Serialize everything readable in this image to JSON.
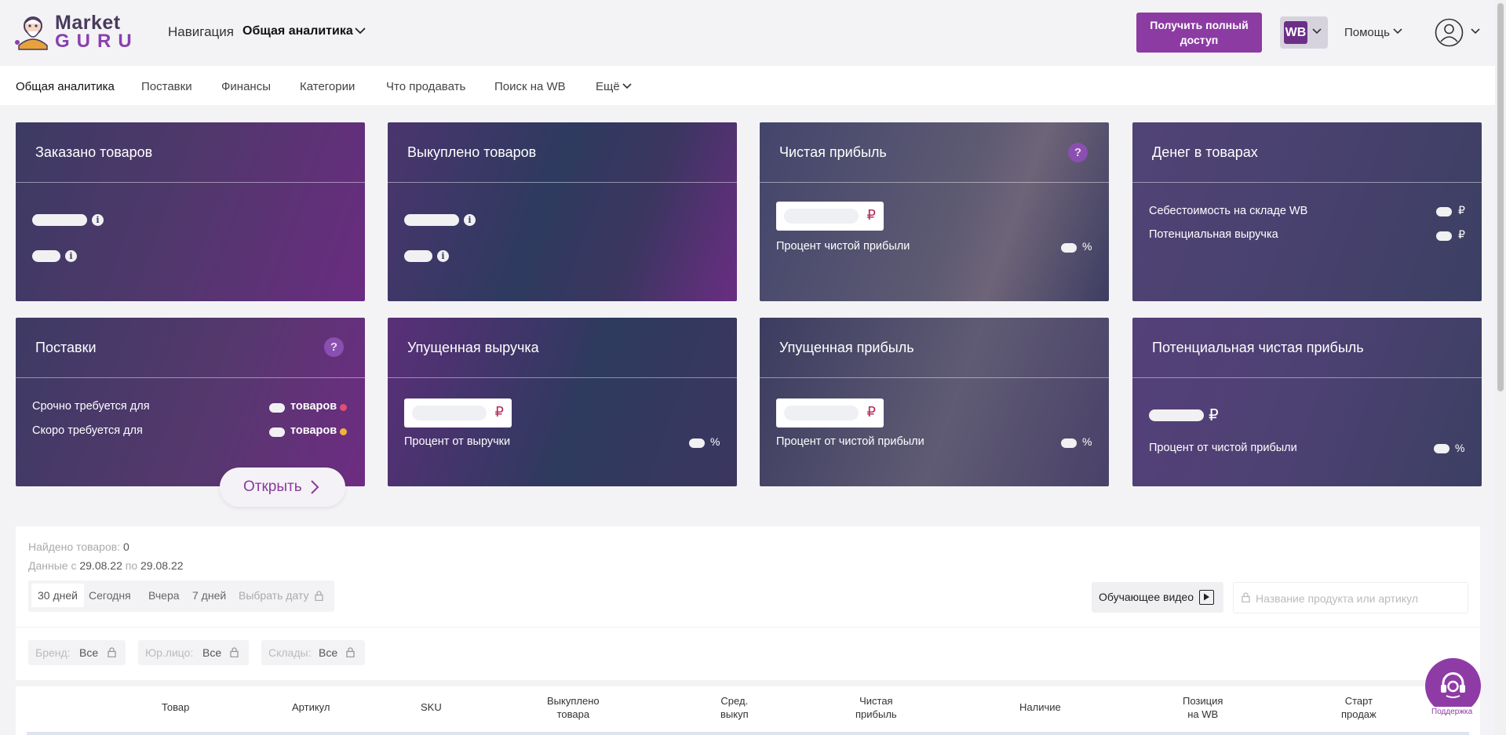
{
  "header": {
    "logo_line1": "Market",
    "logo_line2": "GURU",
    "nav_label": "Навигация",
    "nav_value": "Общая аналитика",
    "cta": "Получить полный доступ",
    "marketplace_badge": "WB",
    "help": "Помощь"
  },
  "subnav": {
    "items": [
      "Общая аналитика",
      "Поставки",
      "Финансы",
      "Категории",
      "Что продавать",
      "Поиск на WB",
      "Ещё"
    ]
  },
  "cards": {
    "ordered": {
      "title": "Заказано товаров"
    },
    "bought": {
      "title": "Выкуплено товаров"
    },
    "net_profit": {
      "title": "Чистая прибыль",
      "currency": "₽",
      "sub_label": "Процент чистой прибыли",
      "unit": "%"
    },
    "money_in_goods": {
      "title": "Денег в товарах",
      "line1": "Себестоимость на складе WB",
      "line2": "Потенциальная выручка",
      "currency": "₽"
    },
    "supplies": {
      "title": "Поставки",
      "line1": "Срочно требуется для",
      "line2": "Скоро требуется для",
      "unit": "товаров",
      "urgent_color": "#e0506e",
      "soon_color": "#f2b33d"
    },
    "lost_revenue": {
      "title": "Упущенная выручка",
      "currency": "₽",
      "sub_label": "Процент от выручки",
      "unit": "%"
    },
    "lost_profit": {
      "title": "Упущенная прибыль",
      "currency": "₽",
      "sub_label": "Процент от чистой прибыли",
      "unit": "%"
    },
    "potential_profit": {
      "title": "Потенциальная чистая прибыль",
      "currency": "₽",
      "sub_label": "Процент от чистой прибыли",
      "unit": "%"
    },
    "help_glyph": "?",
    "info_glyph": "i"
  },
  "open_button": "Открыть",
  "panel": {
    "found_label": "Найдено товаров:",
    "found_value": "0",
    "dates_label1": "Данные с",
    "date_from": "29.08.22",
    "dates_label2": "по",
    "date_to": "29.08.22",
    "periods": [
      "30 дней",
      "Сегодня",
      "Вчера",
      "7 дней",
      "Выбрать дату"
    ],
    "video_button": "Обучающее видео",
    "search_placeholder": "Название продукта или артикул",
    "filters": [
      {
        "key": "Бренд:",
        "value": "Все"
      },
      {
        "key": "Юр.лицо:",
        "value": "Все"
      },
      {
        "key": "Склады:",
        "value": "Все"
      }
    ],
    "columns": [
      "Товар",
      "Артикул",
      "SKU",
      "Выкуплено\nтовара",
      "Сред.\nвыкуп",
      "Чистая\nприбыль",
      "Наличие",
      "Позиция\nна WB",
      "Старт\nпродаж"
    ]
  },
  "support_label": "Поддержка",
  "colors": {
    "accent": "#8c3ba3",
    "danger_ruble": "#b5305a"
  }
}
